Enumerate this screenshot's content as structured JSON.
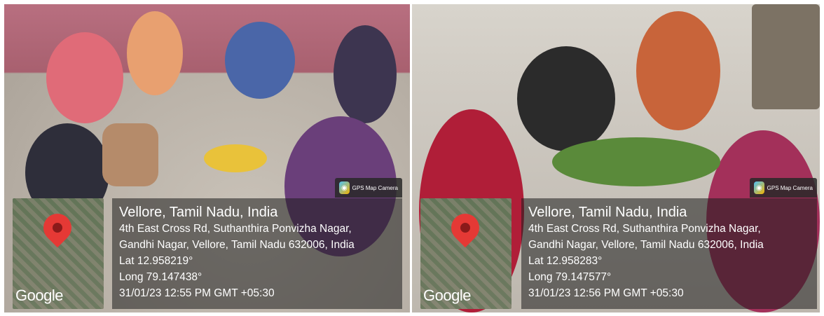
{
  "photos": [
    {
      "gps_badge": {
        "label": "GPS Map Camera",
        "icon": "camera-icon"
      },
      "map": {
        "pin_icon": "map-pin-icon",
        "brand": "Google"
      },
      "location": {
        "title": "Vellore, Tamil Nadu, India",
        "address_line1": "4th East Cross Rd, Suthanthira Ponvizha Nagar,",
        "address_line2": "Gandhi Nagar, Vellore, Tamil Nadu 632006, India",
        "lat": "Lat 12.958219°",
        "long": "Long 79.147438°",
        "timestamp": "31/01/23 12:55 PM GMT +05:30"
      }
    },
    {
      "gps_badge": {
        "label": "GPS Map Camera",
        "icon": "camera-icon"
      },
      "map": {
        "pin_icon": "map-pin-icon",
        "brand": "Google"
      },
      "location": {
        "title": "Vellore, Tamil Nadu, India",
        "address_line1": "4th East Cross Rd, Suthanthira Ponvizha Nagar,",
        "address_line2": "Gandhi Nagar, Vellore, Tamil Nadu 632006, India",
        "lat": "Lat 12.958283°",
        "long": "Long 79.147577°",
        "timestamp": "31/01/23 12:56 PM GMT +05:30"
      }
    }
  ]
}
